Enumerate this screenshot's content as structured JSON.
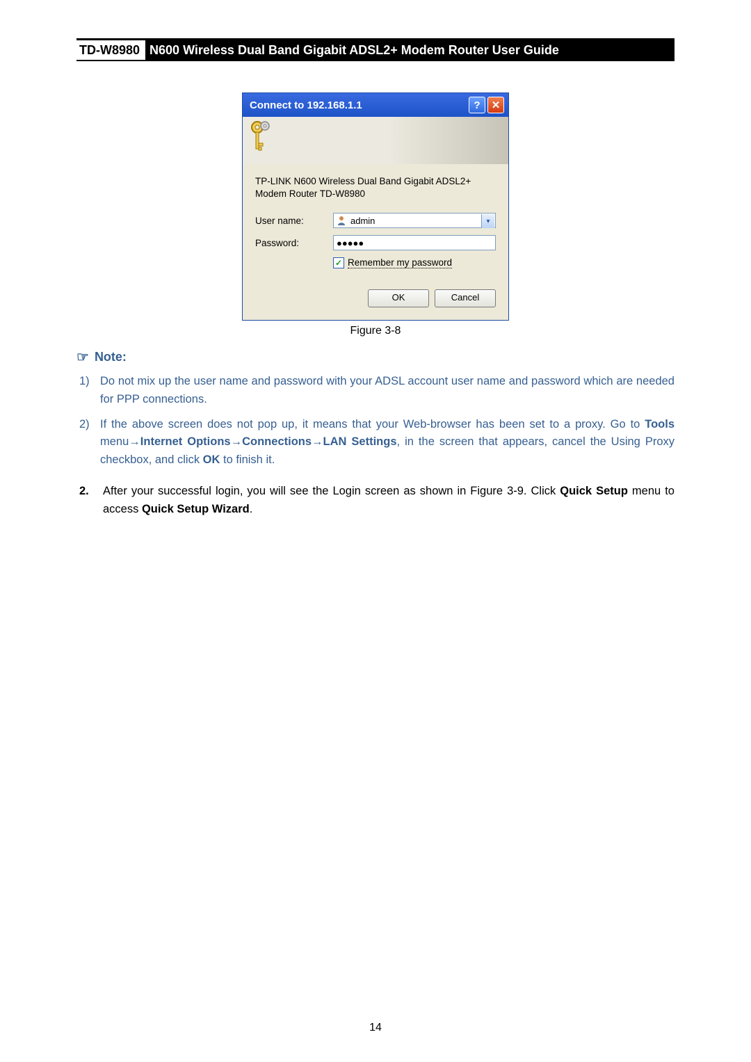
{
  "header": {
    "model": "TD-W8980",
    "title": "N600 Wireless Dual Band Gigabit ADSL2+ Modem Router User Guide"
  },
  "dialog": {
    "title": "Connect to 192.168.1.1",
    "realm": "TP-LINK N600 Wireless Dual Band Gigabit ADSL2+ Modem Router TD-W8980",
    "username_label": "User name:",
    "username_value": "admin",
    "password_label": "Password:",
    "password_value": "●●●●●",
    "remember_label": "Remember my password",
    "ok_label": "OK",
    "cancel_label": "Cancel"
  },
  "figure_caption": "Figure 3-8",
  "note_heading": "Note:",
  "notes": [
    {
      "num": "1)",
      "text": "Do not mix up the user name and password with your ADSL account user name and password which are needed for PPP connections."
    },
    {
      "num": "2)",
      "prefix": "If the above screen does not pop up, it means that your Web-browser has been set to a proxy. Go to ",
      "tools": "Tools",
      "m1": " menu→",
      "io": "Internet Options",
      "a1": "→",
      "conn": "Connections",
      "a2": "→",
      "lan": "LAN Settings",
      "mid": ", in the screen that appears, cancel the Using Proxy checkbox, and click ",
      "ok": "OK",
      "suffix": " to finish it."
    }
  ],
  "step": {
    "num": "2.",
    "pre": "After your successful login, you will see the Login screen as shown in Figure 3-9. Click ",
    "quick_setup": "Quick Setup",
    "mid": " menu to access ",
    "wizard": "Quick Setup Wizard",
    "end": "."
  },
  "page_number": "14"
}
